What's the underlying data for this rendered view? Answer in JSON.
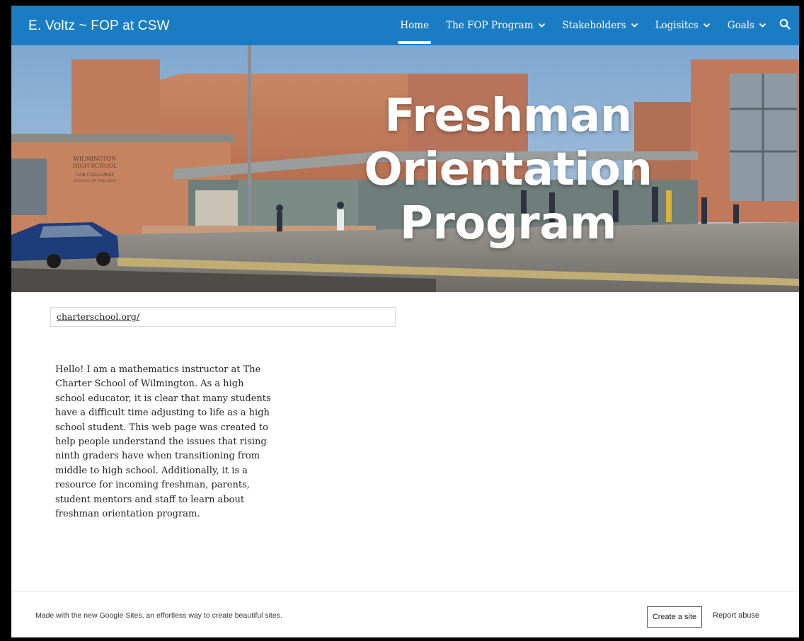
{
  "site": {
    "title": "E. Voltz ~ FOP at CSW"
  },
  "nav": {
    "items": [
      {
        "label": "Home",
        "active": true,
        "has_dropdown": false
      },
      {
        "label": "The FOP Program",
        "active": false,
        "has_dropdown": true
      },
      {
        "label": "Stakeholders",
        "active": false,
        "has_dropdown": true
      },
      {
        "label": "Logisitcs",
        "active": false,
        "has_dropdown": true
      },
      {
        "label": "Goals",
        "active": false,
        "has_dropdown": true
      }
    ],
    "search_icon": "search-icon",
    "dropdown_icon": "chevron-down-icon"
  },
  "hero": {
    "title_lines": [
      "Freshman",
      "Orientation",
      "Program"
    ],
    "building_sign": [
      "WILMINGTON",
      "HIGH SCHOOL",
      "CAB CALLOWAY",
      "SCHOOL OF THE ARTS"
    ]
  },
  "content": {
    "link_text": "charterschool.org/",
    "intro": "Hello! I am a mathematics instructor at The Charter School of Wilmington. As a high school educator, it is clear that many students have a difficult time adjusting to life as a high school student. This web page was created to help people understand the issues that rising ninth graders have when transitioning from middle to high school. Additionally, it is a resource for incoming freshman, parents, student mentors and staff to learn about freshman orientation program."
  },
  "footer": {
    "text": "Made with the new Google Sites, an effortless way to create beautiful sites.",
    "create_label": "Create a site",
    "report_label": "Report abuse"
  },
  "colors": {
    "nav_bar": "#1a7dc4",
    "page_background": "#ffffff",
    "outer_border": "#000000"
  }
}
